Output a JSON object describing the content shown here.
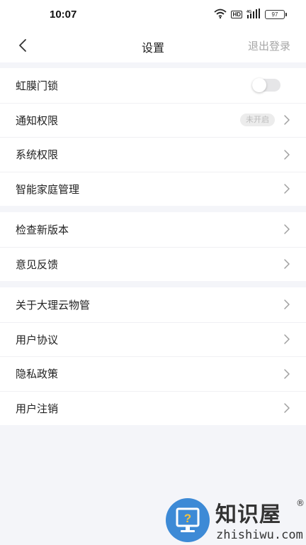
{
  "status_bar": {
    "time": "10:07",
    "hd": "HD",
    "battery": "97"
  },
  "nav": {
    "title": "设置",
    "logout": "退出登录"
  },
  "groups": [
    {
      "items": [
        {
          "label": "虹膜门锁",
          "control": "toggle",
          "on": false
        },
        {
          "label": "通知权限",
          "badge": "未开启",
          "control": "chevron"
        },
        {
          "label": "系统权限",
          "control": "chevron"
        },
        {
          "label": "智能家庭管理",
          "control": "chevron"
        }
      ]
    },
    {
      "items": [
        {
          "label": "检查新版本",
          "control": "chevron"
        },
        {
          "label": "意见反馈",
          "control": "chevron"
        }
      ]
    },
    {
      "items": [
        {
          "label": "关于大理云物管",
          "control": "chevron"
        },
        {
          "label": "用户协议",
          "control": "chevron"
        },
        {
          "label": "隐私政策",
          "control": "chevron"
        },
        {
          "label": "用户注销",
          "control": "chevron"
        }
      ]
    }
  ],
  "watermark": {
    "title": "知识屋",
    "registered": "®",
    "subtitle": "zhishiwu.com"
  },
  "colors": {
    "background": "#f4f5f9",
    "muted_text": "#a6a6a6",
    "watermark_blue": "#3d8ad6"
  }
}
